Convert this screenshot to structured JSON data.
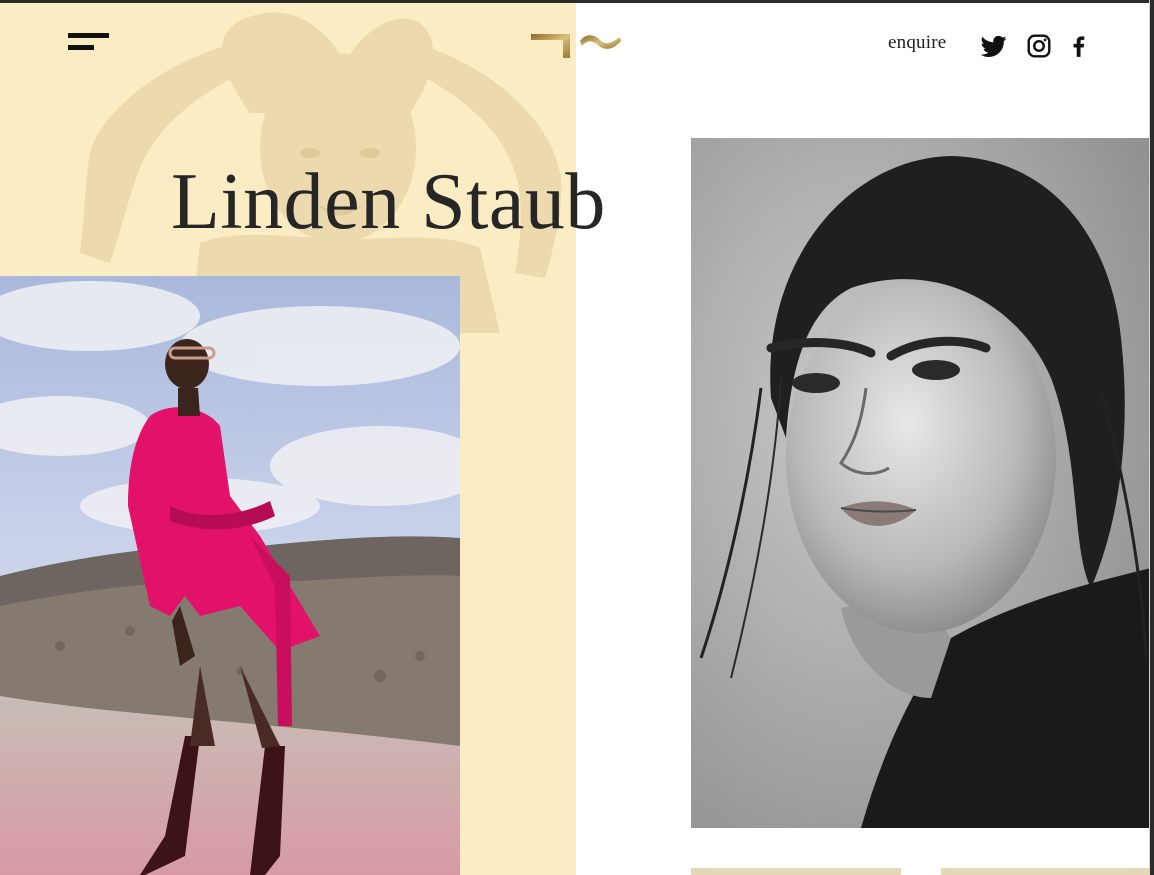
{
  "header": {
    "enquire_label": "enquire",
    "social": [
      "twitter-icon",
      "instagram-icon",
      "facebook-icon"
    ]
  },
  "hero": {
    "title": "Linden Staub"
  },
  "colors": {
    "accent_cream": "#fcecc4",
    "text": "#262626",
    "gold": "#b89b4e",
    "fashion_pink": "#e2126a"
  }
}
